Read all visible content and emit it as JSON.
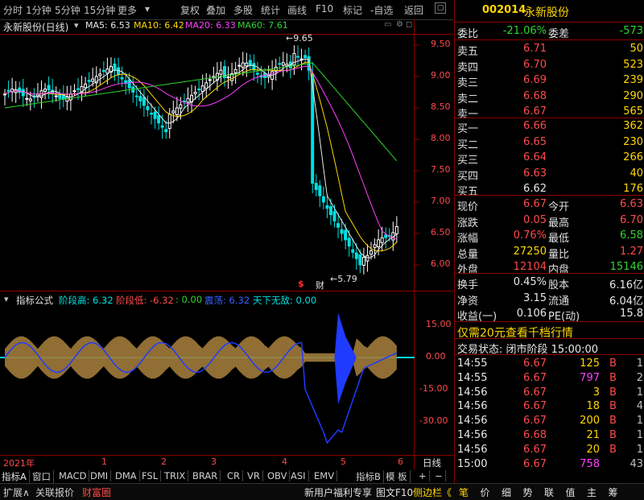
{
  "toolbar": {
    "items": [
      "分时",
      "1分钟",
      "5分钟",
      "15分钟",
      "更多",
      "复权",
      "叠加",
      "多股",
      "统计",
      "画线",
      "F10",
      "标记",
      "-自选",
      "返回"
    ]
  },
  "title": {
    "stock": "永新股份(日线)",
    "ma5": "MA5: 6.53",
    "ma10": "MA10: 6.42",
    "ma20": "MA20: 6.33",
    "ma60": "MA60: 7.61"
  },
  "price_axis": [
    "9.50",
    "9.00",
    "8.50",
    "8.00",
    "7.50",
    "7.00",
    "6.50",
    "6.00"
  ],
  "annotations": {
    "high": "9.65",
    "low": "5.79",
    "dollar": "$",
    "cai": "财"
  },
  "indicator": {
    "label": "指标公式",
    "items": [
      {
        "text": "阶段高: 6.32",
        "color": "#00e0e0"
      },
      {
        "text": "阶段低: -6.32",
        "color": "#ff4a4a"
      },
      {
        "text": ": 0.00",
        "color": "#2fd42f"
      },
      {
        "text": "震荡: 6.32",
        "color": "#3a5fff"
      },
      {
        "text": "天下无敌: 0.00",
        "color": "#00e0e0"
      }
    ],
    "axis": [
      "15.00",
      "0.00",
      "-15.00",
      "-30.00"
    ]
  },
  "time_axis": {
    "year": "2021年",
    "months": [
      "1",
      "2",
      "3",
      "4",
      "5",
      "6"
    ],
    "period_label": "日线"
  },
  "bottom_tabs": [
    "指标A",
    "窗口",
    "MACD",
    "DMI",
    "DMA",
    "FSL",
    "TRIX",
    "BRAR",
    "CR",
    "VR",
    "OBV",
    "ASI",
    "EMV",
    "指标B",
    "模 板",
    "+",
    "−"
  ],
  "status_bar": {
    "left": [
      "扩展∧",
      "关联报价",
      "财富圈"
    ],
    "middle": "新用户福利专享",
    "f10": "图文F10",
    "side": "侧边栏《",
    "right": [
      "笔",
      "价",
      "细",
      "势",
      "联",
      "值",
      "主",
      "筹"
    ]
  },
  "quote": {
    "code": "002014",
    "name": "永新股份",
    "weibi_label": "委比",
    "weibi": "-21.06%",
    "weicha_label": "委差",
    "weicha": "-573",
    "sells": [
      {
        "label": "卖五",
        "price": "6.71",
        "vol": "50"
      },
      {
        "label": "卖四",
        "price": "6.70",
        "vol": "523"
      },
      {
        "label": "卖三",
        "price": "6.69",
        "vol": "239"
      },
      {
        "label": "卖二",
        "price": "6.68",
        "vol": "290"
      },
      {
        "label": "卖一",
        "price": "6.67",
        "vol": "565"
      }
    ],
    "buys": [
      {
        "label": "买一",
        "price": "6.66",
        "vol": "362"
      },
      {
        "label": "买二",
        "price": "6.65",
        "vol": "230"
      },
      {
        "label": "买三",
        "price": "6.64",
        "vol": "266"
      },
      {
        "label": "买四",
        "price": "6.63",
        "vol": "40"
      },
      {
        "label": "买五",
        "price": "6.62",
        "vol": "176"
      }
    ],
    "stats": [
      {
        "l1": "现价",
        "v1": "6.67",
        "c1": "#ff4a4a",
        "l2": "今开",
        "v2": "6.63",
        "c2": "#ff4a4a"
      },
      {
        "l1": "涨跌",
        "v1": "0.05",
        "c1": "#ff4a4a",
        "l2": "最高",
        "v2": "6.70",
        "c2": "#ff4a4a"
      },
      {
        "l1": "涨幅",
        "v1": "0.76%",
        "c1": "#ff4a4a",
        "l2": "最低",
        "v2": "6.58",
        "c2": "#2fd42f"
      },
      {
        "l1": "总量",
        "v1": "27250",
        "c1": "#ffd700",
        "l2": "量比",
        "v2": "1.27",
        "c2": "#ff4a4a"
      },
      {
        "l1": "外盘",
        "v1": "12104",
        "c1": "#ff4a4a",
        "l2": "内盘",
        "v2": "15146",
        "c2": "#2fd42f"
      }
    ],
    "fund": [
      {
        "l1": "换手",
        "v1": "0.45%",
        "l2": "股本",
        "v2": "6.16亿"
      },
      {
        "l1": "净资",
        "v1": "3.15",
        "l2": "流通",
        "v2": "6.04亿"
      },
      {
        "l1": "收益(一)",
        "v1": "0.106",
        "l2": "PE(动)",
        "v2": "15.8"
      }
    ],
    "promo": "仅需20元查看千档行情",
    "trade_state": "交易状态: 闭市阶段 15:00:00",
    "ticks": [
      {
        "t": "14:55",
        "p": "6.67",
        "v": "125",
        "s": "B",
        "n": "1"
      },
      {
        "t": "14:55",
        "p": "6.67",
        "v": "797",
        "s": "B",
        "n": "2"
      },
      {
        "t": "14:56",
        "p": "6.67",
        "v": "3",
        "s": "B",
        "n": "1"
      },
      {
        "t": "14:56",
        "p": "6.67",
        "v": "18",
        "s": "B",
        "n": "4"
      },
      {
        "t": "14:56",
        "p": "6.67",
        "v": "200",
        "s": "B",
        "n": "1"
      },
      {
        "t": "14:56",
        "p": "6.68",
        "v": "21",
        "s": "B",
        "n": "1"
      },
      {
        "t": "14:56",
        "p": "6.67",
        "v": "20",
        "s": "B",
        "n": "1"
      },
      {
        "t": "15:00",
        "p": "6.67",
        "v": "758",
        "s": "",
        "n": "43"
      }
    ]
  },
  "chart_data": {
    "type": "candlestick",
    "ma_labels": [
      "MA5",
      "MA10",
      "MA20",
      "MA60"
    ],
    "ylim": [
      5.6,
      9.8
    ],
    "x_months": [
      "2021年",
      "1",
      "2",
      "3",
      "4",
      "5",
      "6"
    ]
  }
}
